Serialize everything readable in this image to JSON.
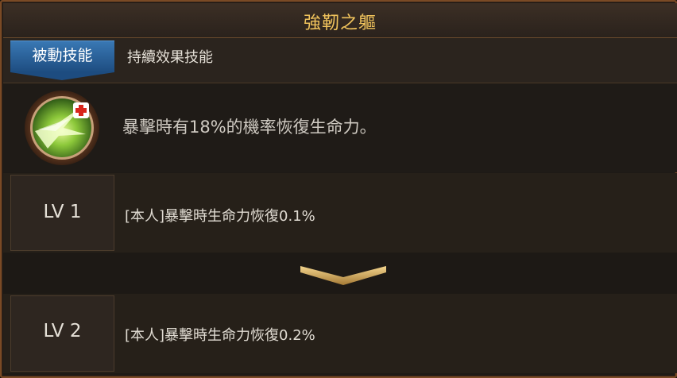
{
  "window": {
    "title": "強靭之軀"
  },
  "skill_type": {
    "tab_label": "被動技能",
    "description": "持續效果技能"
  },
  "skill": {
    "icon": "green-slash-heal-icon",
    "description": "暴擊時有18%的機率恢復生命力。"
  },
  "levels": [
    {
      "label": "LV 1",
      "effect": "[本人]暴擊時生命力恢復0.1%"
    },
    {
      "label": "LV 2",
      "effect": "[本人]暴擊時生命力恢復0.2%"
    }
  ],
  "colors": {
    "title": "#f0c35c",
    "tab_blue": "#2e6aa6",
    "border_brown": "#7a4a25",
    "chevron_gold": "#d8b266"
  }
}
